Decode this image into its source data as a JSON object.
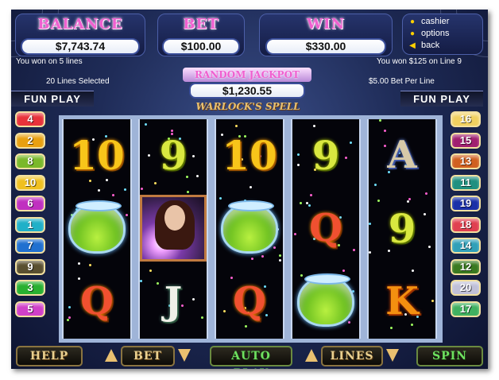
{
  "header": {
    "balance_label": "BALANCE",
    "balance_value": "$7,743.74",
    "bet_label": "BET",
    "bet_value": "$100.00",
    "win_label": "WIN",
    "win_value": "$330.00"
  },
  "menu": {
    "items": [
      {
        "label": "cashier",
        "icon": "coin-icon"
      },
      {
        "label": "options",
        "icon": "coin-icon"
      },
      {
        "label": "back",
        "icon": "back-arrow-icon"
      }
    ]
  },
  "messages": {
    "left_top": "You won on 5 lines",
    "left_bottom": "20 Lines Selected",
    "right_top": "You won $125 on Line 9",
    "right_bottom": "$5.00 Bet Per Line"
  },
  "jackpot": {
    "label": "RANDOM JACKPOT",
    "value": "$1,230.55"
  },
  "game_title": "WARLOCK'S SPELL",
  "fun_play_left": "FUN PLAY",
  "fun_play_right": "FUN PLAY",
  "lines_left": [
    {
      "n": "4",
      "color": "#e8323a"
    },
    {
      "n": "2",
      "color": "#e8a010"
    },
    {
      "n": "8",
      "color": "#7ab82a"
    },
    {
      "n": "10",
      "color": "#f0c020"
    },
    {
      "n": "6",
      "color": "#c030c0"
    },
    {
      "n": "1",
      "color": "#20b0c8"
    },
    {
      "n": "7",
      "color": "#2070d0"
    },
    {
      "n": "9",
      "color": "#5a5030"
    },
    {
      "n": "3",
      "color": "#28b030"
    },
    {
      "n": "5",
      "color": "#d040c8"
    }
  ],
  "lines_right": [
    {
      "n": "16",
      "color": "#f0d060"
    },
    {
      "n": "15",
      "color": "#a02070"
    },
    {
      "n": "13",
      "color": "#d06020"
    },
    {
      "n": "11",
      "color": "#209080"
    },
    {
      "n": "19",
      "color": "#1a30a8"
    },
    {
      "n": "18",
      "color": "#e04050"
    },
    {
      "n": "14",
      "color": "#30a0b8"
    },
    {
      "n": "12",
      "color": "#3a7a20"
    },
    {
      "n": "20",
      "color": "#c0c0d8"
    },
    {
      "n": "17",
      "color": "#40b060"
    }
  ],
  "reels": [
    [
      "10",
      "cauldron",
      "Q"
    ],
    [
      "9",
      "warlock",
      "J"
    ],
    [
      "10",
      "cauldron",
      "Q"
    ],
    [
      "9",
      "Q",
      "cauldron"
    ],
    [
      "A",
      "9",
      "K"
    ]
  ],
  "controls": {
    "help": "HELP",
    "bet": "BET",
    "auto_play": "AUTO PLAY",
    "lines": "LINES",
    "spin": "SPIN"
  }
}
